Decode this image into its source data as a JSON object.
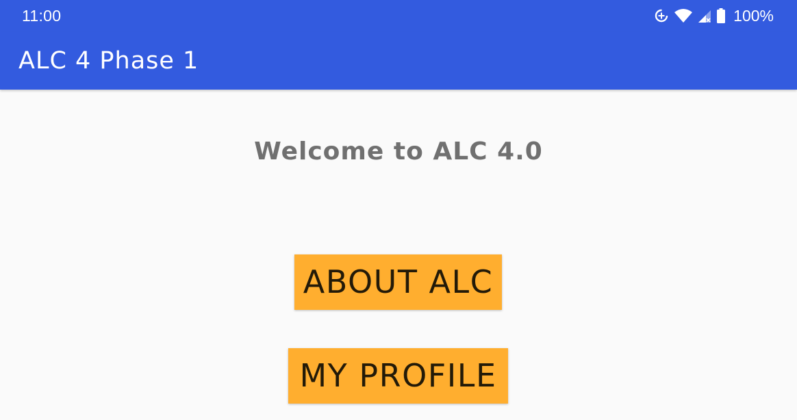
{
  "status_bar": {
    "time": "11:00",
    "battery_percent": "100%",
    "icons": [
      "data-saver-icon",
      "wifi-icon",
      "cellular-signal-icon",
      "battery-icon"
    ]
  },
  "app_bar": {
    "title": "ALC 4 Phase 1"
  },
  "main": {
    "welcome_text": "Welcome to ALC 4.0",
    "about_button_label": "ABOUT ALC",
    "profile_button_label": "MY PROFILE"
  },
  "colors": {
    "primary": "#335bdf",
    "accent": "#ffae2f",
    "background": "#fafafa",
    "welcome_text": "#707070"
  }
}
